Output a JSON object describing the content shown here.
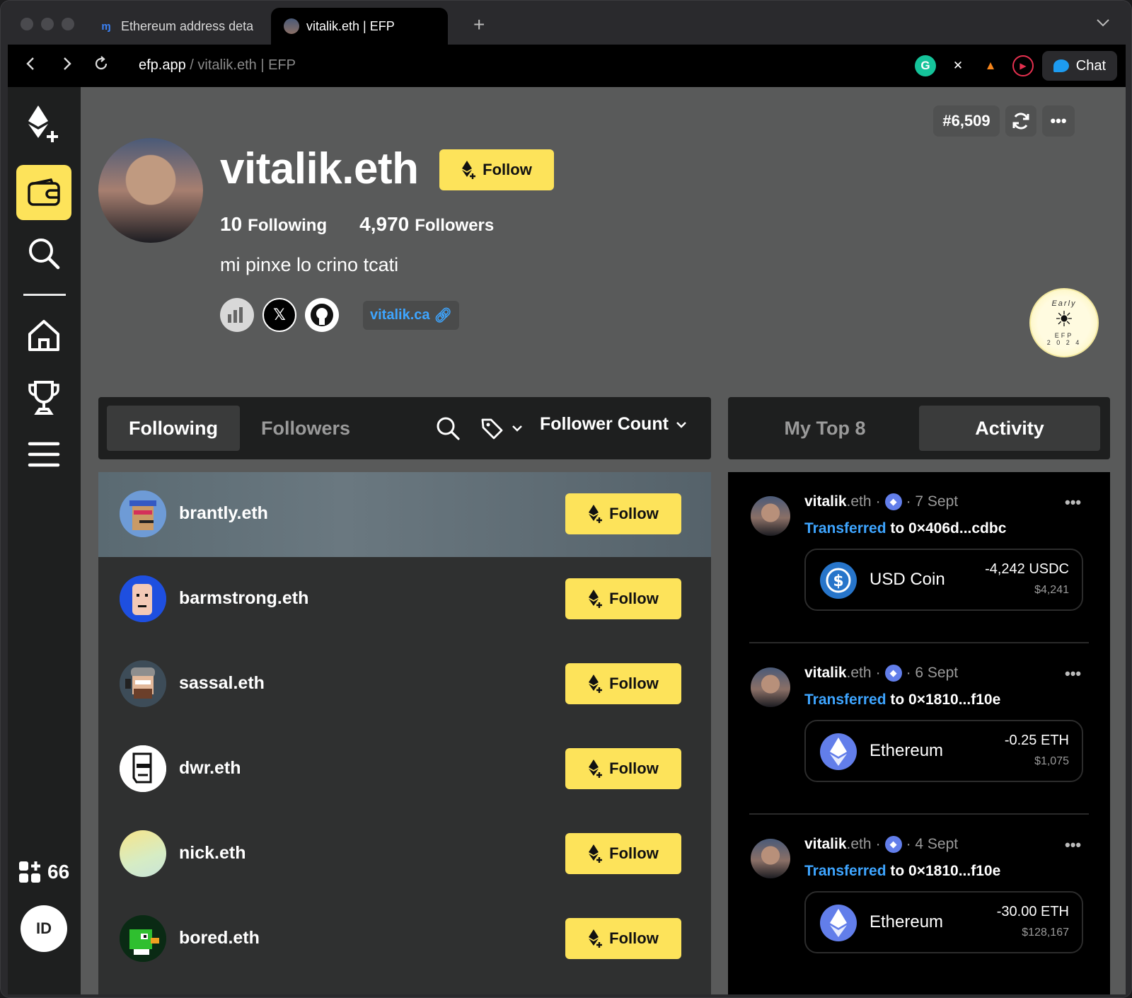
{
  "browser": {
    "tabs": [
      {
        "title": "Ethereum address deta",
        "active": false
      },
      {
        "title": "vitalik.eth | EFP",
        "active": true
      }
    ],
    "new_tab": "+",
    "url_domain": "efp.app",
    "url_path": " / vitalik.eth | EFP",
    "chat_label": "Chat"
  },
  "sidebar": {
    "items": [
      "efp-logo",
      "wallet",
      "search",
      "home",
      "leaderboard",
      "menu"
    ],
    "count": "66",
    "id_label": "ID"
  },
  "profile": {
    "rank": "#6,509",
    "name": "vitalik.eth",
    "follow_label": "Follow",
    "following_count": "10",
    "following_label": "Following",
    "followers_count": "4,970",
    "followers_label": "Followers",
    "bio": "mi pinxe lo crino tcati",
    "website": "vitalik.ca",
    "badge": {
      "top": "Early",
      "mid": "EFP",
      "year": "2 0 2 4"
    }
  },
  "following_panel": {
    "tab_following": "Following",
    "tab_followers": "Followers",
    "sort_label": "Follower Count",
    "rows": [
      {
        "name": "brantly.eth",
        "follow": "Follow"
      },
      {
        "name": "barmstrong.eth",
        "follow": "Follow"
      },
      {
        "name": "sassal.eth",
        "follow": "Follow"
      },
      {
        "name": "dwr.eth",
        "follow": "Follow"
      },
      {
        "name": "nick.eth",
        "follow": "Follow"
      },
      {
        "name": "bored.eth",
        "follow": "Follow"
      }
    ]
  },
  "activity_panel": {
    "tab_top8": "My Top 8",
    "tab_activity": "Activity",
    "items": [
      {
        "user": "vitalik",
        "suffix": ".eth",
        "date": "· 7 Sept",
        "verb": "Transferred",
        "rest": " to 0×406d...cdbc",
        "asset": "USD Coin",
        "amount": "-4,242 USDC",
        "usd": "$4,241",
        "icon": "usdc"
      },
      {
        "user": "vitalik",
        "suffix": ".eth",
        "date": "· 6 Sept",
        "verb": "Transferred",
        "rest": " to 0×1810...f10e",
        "asset": "Ethereum",
        "amount": "-0.25 ETH",
        "usd": "$1,075",
        "icon": "eth"
      },
      {
        "user": "vitalik",
        "suffix": ".eth",
        "date": "· 4 Sept",
        "verb": "Transferred",
        "rest": " to 0×1810...f10e",
        "asset": "Ethereum",
        "amount": "-30.00 ETH",
        "usd": "$128,167",
        "icon": "eth"
      }
    ]
  },
  "colors": {
    "accent": "#fde35a",
    "link": "#3ea5ff",
    "eth": "#627eea",
    "usdc": "#2775ca"
  }
}
